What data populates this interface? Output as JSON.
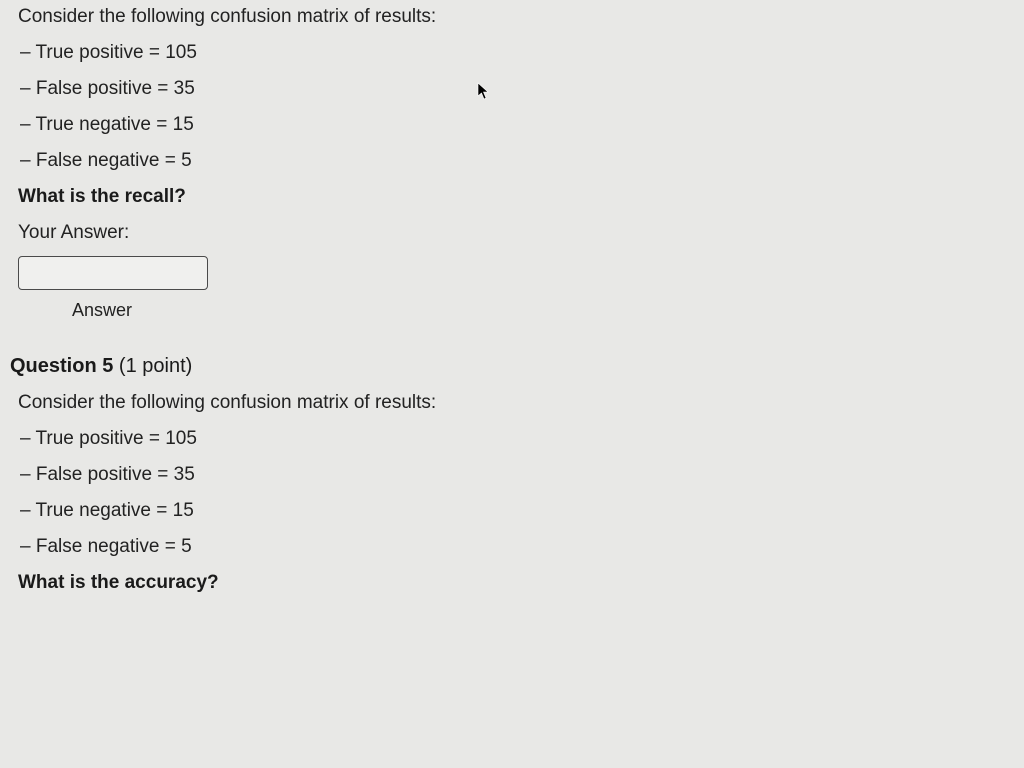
{
  "q4": {
    "prompt": "Consider the following confusion matrix of results:",
    "bullets": [
      "– True positive = 105",
      "– False positive = 35",
      "– True negative = 15",
      "– False negative = 5"
    ],
    "question": "What is the recall?",
    "answer_label": "Your Answer:",
    "input_value": "",
    "caption": "Answer"
  },
  "q5": {
    "header_num": "Question 5",
    "header_points": " (1 point)",
    "prompt": "Consider the following confusion matrix of results:",
    "bullets": [
      "– True positive = 105",
      "– False positive = 35",
      "– True negative = 15",
      "– False negative = 5"
    ],
    "question": "What is the accuracy?"
  }
}
